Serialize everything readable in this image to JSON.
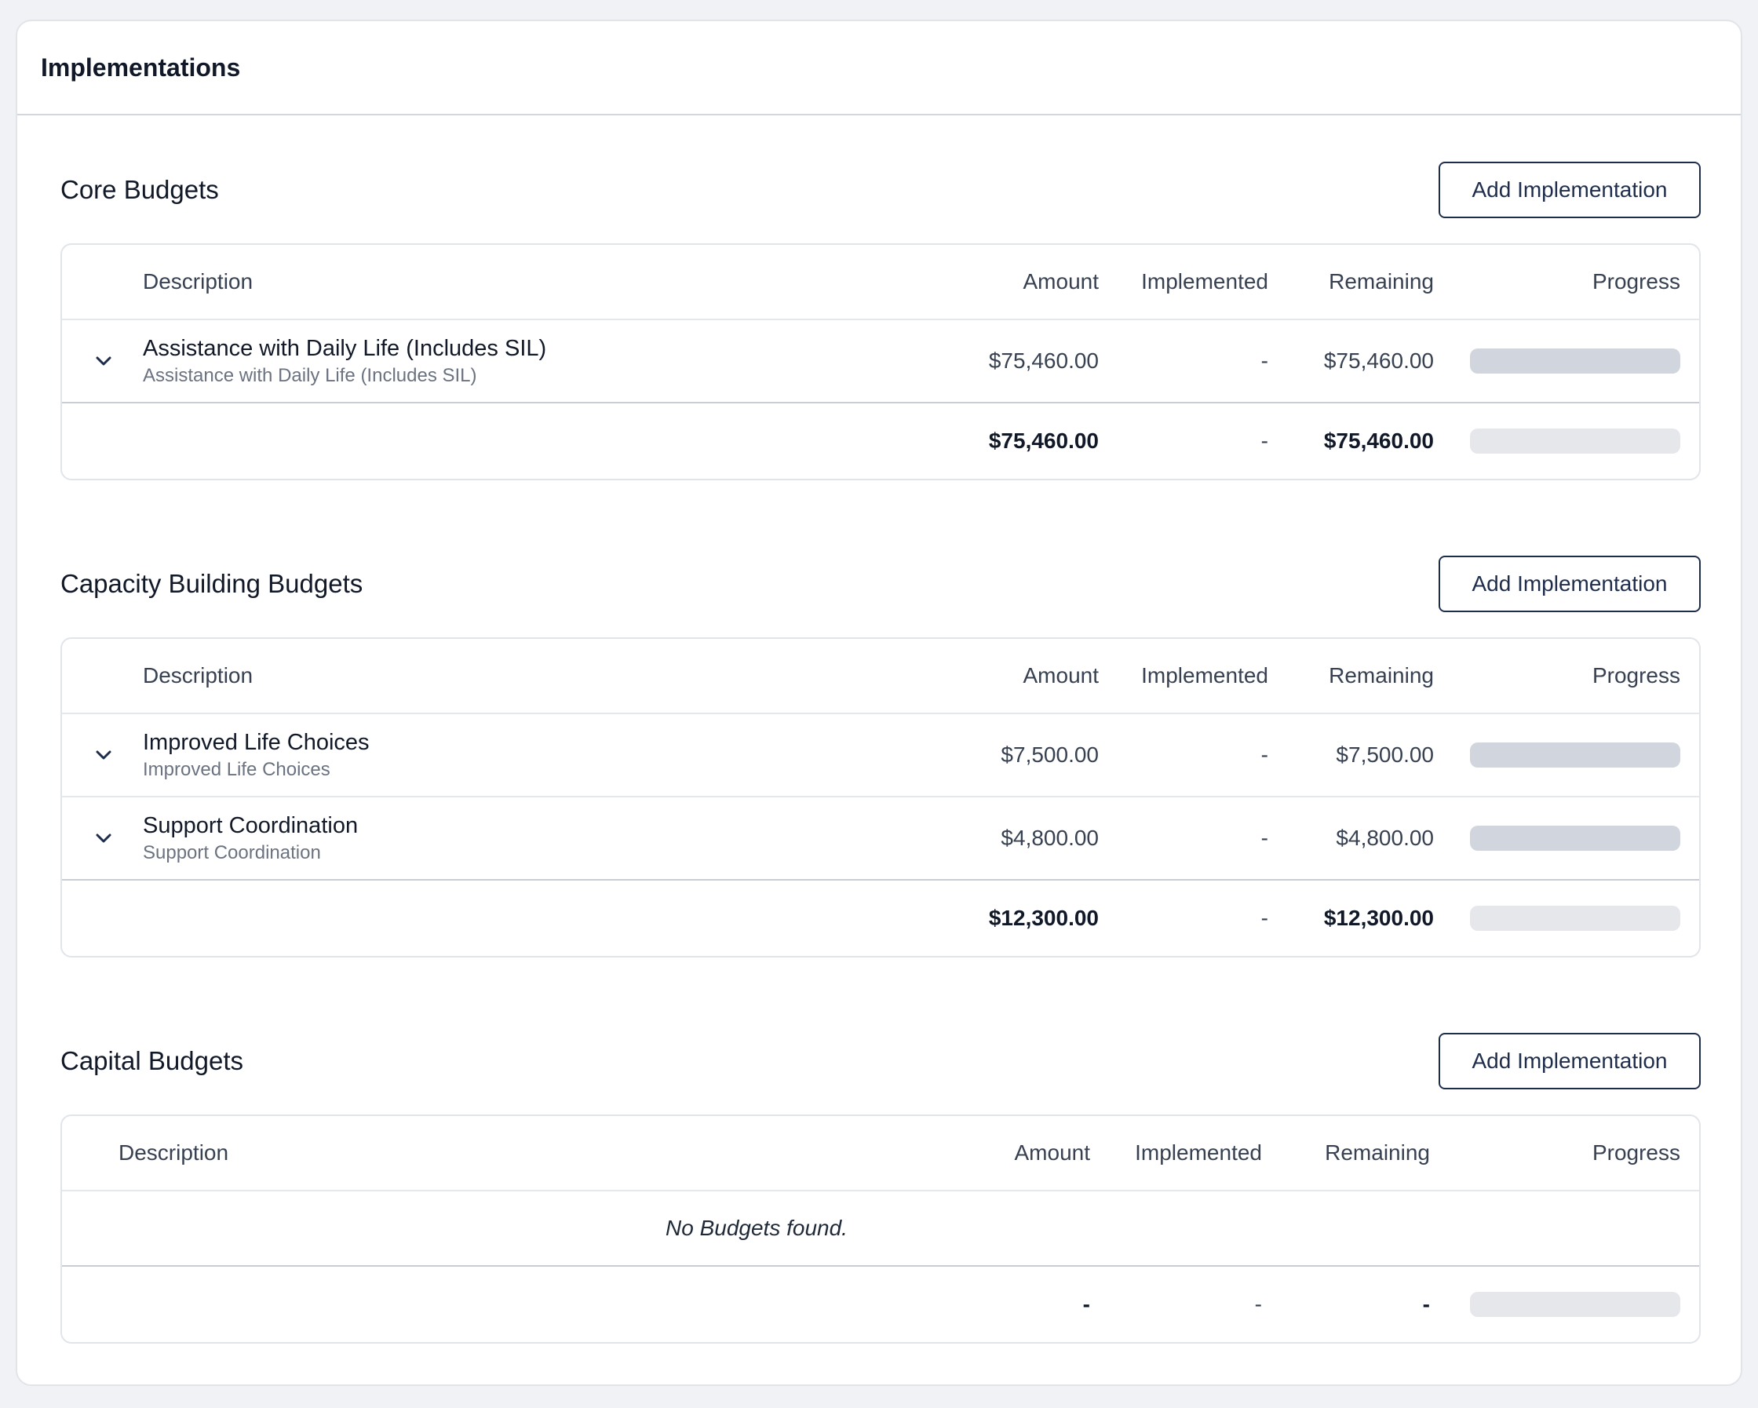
{
  "card": {
    "title": "Implementations"
  },
  "columns": {
    "description": "Description",
    "amount": "Amount",
    "implemented": "Implemented",
    "remaining": "Remaining",
    "progress": "Progress"
  },
  "add_button_label": "Add Implementation",
  "sections": [
    {
      "title": "Core Budgets",
      "rows": [
        {
          "name": "Assistance with Daily Life (Includes SIL)",
          "sub": "Assistance with Daily Life (Includes SIL)",
          "amount": "$75,460.00",
          "implemented": "-",
          "remaining": "$75,460.00",
          "progress": 0
        }
      ],
      "totals": {
        "amount": "$75,460.00",
        "implemented": "-",
        "remaining": "$75,460.00",
        "progress": 0
      }
    },
    {
      "title": "Capacity Building Budgets",
      "rows": [
        {
          "name": "Improved Life Choices",
          "sub": "Improved Life Choices",
          "amount": "$7,500.00",
          "implemented": "-",
          "remaining": "$7,500.00",
          "progress": 0
        },
        {
          "name": "Support Coordination",
          "sub": "Support Coordination",
          "amount": "$4,800.00",
          "implemented": "-",
          "remaining": "$4,800.00",
          "progress": 0
        }
      ],
      "totals": {
        "amount": "$12,300.00",
        "implemented": "-",
        "remaining": "$12,300.00",
        "progress": 0
      }
    },
    {
      "title": "Capital Budgets",
      "rows": [],
      "empty_message": "No Budgets found.",
      "totals": {
        "amount": "-",
        "implemented": "-",
        "remaining": "-",
        "progress": 0
      }
    }
  ],
  "icons": {
    "expand": "chevron-down-icon"
  },
  "colors": {
    "accent": "#1f2d4d",
    "progress_track": "#d1d5dd",
    "progress_track_total": "#e5e7eb"
  }
}
